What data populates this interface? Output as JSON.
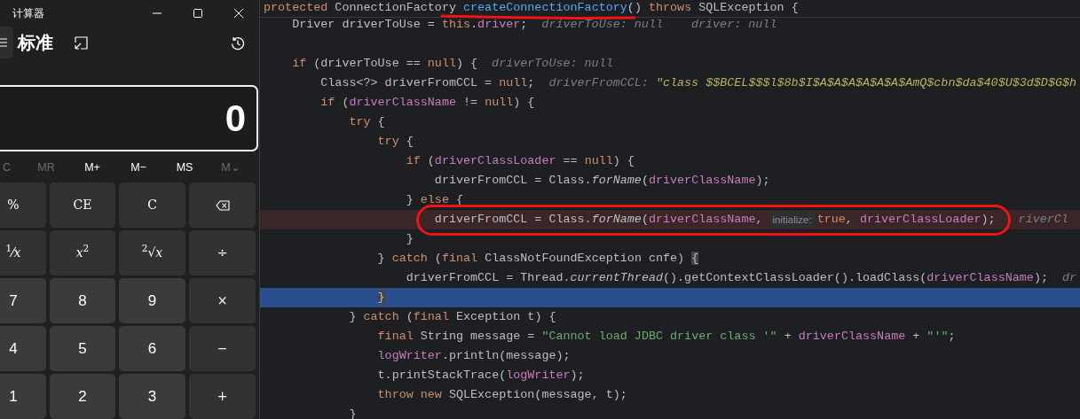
{
  "calculator": {
    "title": "计算器",
    "mode": "标准",
    "display": "0",
    "memory": [
      {
        "label": "C",
        "disabled": true
      },
      {
        "label": "MR",
        "disabled": true
      },
      {
        "label": "M+",
        "disabled": false
      },
      {
        "label": "M−",
        "disabled": false
      },
      {
        "label": "MS",
        "disabled": false
      },
      {
        "label": "M⌄",
        "disabled": true
      }
    ],
    "keys": [
      {
        "label": "%",
        "kind": "function"
      },
      {
        "label": "CE",
        "kind": "function"
      },
      {
        "label": "C",
        "kind": "function"
      },
      {
        "kind": "backspace"
      },
      {
        "label": "$^{1}$⁄*x*",
        "kind": "function"
      },
      {
        "label": "*x*$^{2}$",
        "kind": "function"
      },
      {
        "label": "$^{2}$√*x*",
        "kind": "function"
      },
      {
        "label": "÷",
        "kind": "function"
      },
      {
        "label": "7",
        "kind": "number"
      },
      {
        "label": "8",
        "kind": "number"
      },
      {
        "label": "9",
        "kind": "number"
      },
      {
        "label": "×",
        "kind": "function"
      },
      {
        "label": "4",
        "kind": "number"
      },
      {
        "label": "5",
        "kind": "number"
      },
      {
        "label": "6",
        "kind": "number"
      },
      {
        "label": "−",
        "kind": "function"
      },
      {
        "label": "1",
        "kind": "number"
      },
      {
        "label": "2",
        "kind": "number"
      },
      {
        "label": "3",
        "kind": "number"
      },
      {
        "label": "+",
        "kind": "function"
      }
    ]
  },
  "editor": {
    "lines": [
      {
        "kind": "code",
        "code": [
          {
            "kind": "kw",
            "text": "protected "
          },
          {
            "kind": "plain",
            "text": "ConnectionFactory "
          },
          {
            "kind": "fn",
            "text": "createConnectionFactory",
            "underlined": true
          },
          {
            "kind": "plain",
            "text": "() "
          },
          {
            "kind": "kw",
            "text": "throws "
          },
          {
            "kind": "plain",
            "text": "SQLException {"
          }
        ]
      },
      {
        "kind": "code",
        "code": [
          {
            "kind": "plain",
            "text": "    Driver driverToUse = "
          },
          {
            "kind": "kw",
            "text": "this"
          },
          {
            "kind": "plain",
            "text": "."
          },
          {
            "kind": "field",
            "text": "driver"
          },
          {
            "kind": "plain",
            "text": ";"
          }
        ],
        "hints": [
          [
            {
              "kind": "hint",
              "text": "driverToUse: null"
            }
          ],
          [
            {
              "kind": "hint",
              "text": "driver: null"
            }
          ]
        ]
      },
      {
        "kind": "blank"
      },
      {
        "kind": "code",
        "code": [
          {
            "kind": "kw",
            "text": "    if"
          },
          {
            "kind": "plain",
            "text": " (driverToUse == "
          },
          {
            "kind": "kw",
            "text": "null"
          },
          {
            "kind": "plain",
            "text": ") {"
          }
        ],
        "hints": [
          [
            {
              "kind": "hint",
              "text": "driverToUse: null"
            }
          ]
        ]
      },
      {
        "kind": "code",
        "code": [
          {
            "kind": "plain",
            "text": "        Class<?> driverFromCCL = "
          },
          {
            "kind": "kw",
            "text": "null"
          },
          {
            "kind": "plain",
            "text": ";"
          }
        ],
        "hints": [
          [
            {
              "kind": "hint",
              "text": "driverFromCCL: "
            },
            {
              "kind": "hint-str",
              "text": "\"class $$BCEL$$$l$8b$I$A$A$A$A$A$A$AmQ$cbn$da$40$U$3d$D$G$h"
            }
          ]
        ]
      },
      {
        "kind": "code",
        "code": [
          {
            "kind": "kw",
            "text": "        if"
          },
          {
            "kind": "plain",
            "text": " ("
          },
          {
            "kind": "field",
            "text": "driverClassName"
          },
          {
            "kind": "plain",
            "text": " != "
          },
          {
            "kind": "kw",
            "text": "null"
          },
          {
            "kind": "plain",
            "text": ") {"
          }
        ]
      },
      {
        "kind": "code",
        "code": [
          {
            "kind": "kw",
            "text": "            try"
          },
          {
            "kind": "plain",
            "text": " {"
          }
        ]
      },
      {
        "kind": "code",
        "code": [
          {
            "kind": "kw",
            "text": "                try"
          },
          {
            "kind": "plain",
            "text": " {"
          }
        ]
      },
      {
        "kind": "code",
        "code": [
          {
            "kind": "kw",
            "text": "                    if"
          },
          {
            "kind": "plain",
            "text": " ("
          },
          {
            "kind": "field",
            "text": "driverClassLoader"
          },
          {
            "kind": "plain",
            "text": " == "
          },
          {
            "kind": "kw",
            "text": "null"
          },
          {
            "kind": "plain",
            "text": ") {"
          }
        ]
      },
      {
        "kind": "code",
        "code": [
          {
            "kind": "plain",
            "text": "                        driverFromCCL = Class."
          },
          {
            "kind": "italic",
            "text": "forName"
          },
          {
            "kind": "plain",
            "text": "("
          },
          {
            "kind": "field",
            "text": "driverClassName"
          },
          {
            "kind": "plain",
            "text": ");"
          }
        ]
      },
      {
        "kind": "code",
        "code": [
          {
            "kind": "plain",
            "text": "                    } "
          },
          {
            "kind": "kw",
            "text": "else"
          },
          {
            "kind": "plain",
            "text": " {"
          }
        ]
      },
      {
        "kind": "breakpoint",
        "circled": true,
        "code": [
          {
            "kind": "plain",
            "text": "                        driverFromCCL = Class."
          },
          {
            "kind": "italic",
            "text": "forName"
          },
          {
            "kind": "plain",
            "text": "("
          },
          {
            "kind": "field",
            "text": "driverClassName"
          },
          {
            "kind": "plain",
            "text": ", "
          },
          {
            "kind": "inlay",
            "text": "initialize:"
          },
          {
            "kind": "kw",
            "text": "true"
          },
          {
            "kind": "plain",
            "text": ", "
          },
          {
            "kind": "field",
            "text": "driverClassLoader"
          },
          {
            "kind": "plain",
            "text": ");"
          }
        ],
        "hints": [
          [
            {
              "kind": "hint",
              "text": "riverCl"
            }
          ]
        ]
      },
      {
        "kind": "code",
        "code": [
          {
            "kind": "plain",
            "text": "                    }"
          }
        ]
      },
      {
        "kind": "code",
        "code": [
          {
            "kind": "plain",
            "text": "                } "
          },
          {
            "kind": "kw",
            "text": "catch"
          },
          {
            "kind": "plain",
            "text": " ("
          },
          {
            "kind": "kw",
            "text": "final"
          },
          {
            "kind": "plain",
            "text": " ClassNotFoundException cnfe) "
          },
          {
            "kind": "brace-match",
            "text": "{"
          }
        ]
      },
      {
        "kind": "code",
        "code": [
          {
            "kind": "plain",
            "text": "                    driverFromCCL = Thread."
          },
          {
            "kind": "italic",
            "text": "currentThread"
          },
          {
            "kind": "plain",
            "text": "().getContextClassLoader().loadClass("
          },
          {
            "kind": "field",
            "text": "driverClassName"
          },
          {
            "kind": "plain",
            "text": ");"
          }
        ],
        "hints": [
          [
            {
              "kind": "hint",
              "text": "dr"
            }
          ]
        ]
      },
      {
        "kind": "execution",
        "code": [
          {
            "kind": "brace-match",
            "text": "                }"
          }
        ]
      },
      {
        "kind": "code",
        "code": [
          {
            "kind": "plain",
            "text": "            } "
          },
          {
            "kind": "kw",
            "text": "catch"
          },
          {
            "kind": "plain",
            "text": " ("
          },
          {
            "kind": "kw",
            "text": "final"
          },
          {
            "kind": "plain",
            "text": " Exception t) {"
          }
        ]
      },
      {
        "kind": "code",
        "code": [
          {
            "kind": "kw",
            "text": "                final"
          },
          {
            "kind": "plain",
            "text": " String message = "
          },
          {
            "kind": "str",
            "text": "\"Cannot load JDBC driver class '\""
          },
          {
            "kind": "plain",
            "text": " + "
          },
          {
            "kind": "field",
            "text": "driverClassName"
          },
          {
            "kind": "plain",
            "text": " + "
          },
          {
            "kind": "str",
            "text": "\"'\""
          },
          {
            "kind": "plain",
            "text": ";"
          }
        ]
      },
      {
        "kind": "code",
        "code": [
          {
            "kind": "field",
            "text": "                logWriter"
          },
          {
            "kind": "plain",
            "text": ".println(message);"
          }
        ]
      },
      {
        "kind": "code",
        "code": [
          {
            "kind": "plain",
            "text": "                t.printStackTrace("
          },
          {
            "kind": "field",
            "text": "logWriter"
          },
          {
            "kind": "plain",
            "text": ");"
          }
        ]
      },
      {
        "kind": "code",
        "code": [
          {
            "kind": "kw",
            "text": "                throw new"
          },
          {
            "kind": "plain",
            "text": " SQLException(message, t);"
          }
        ]
      },
      {
        "kind": "code",
        "code": [
          {
            "kind": "plain",
            "text": "            }"
          }
        ]
      }
    ]
  }
}
